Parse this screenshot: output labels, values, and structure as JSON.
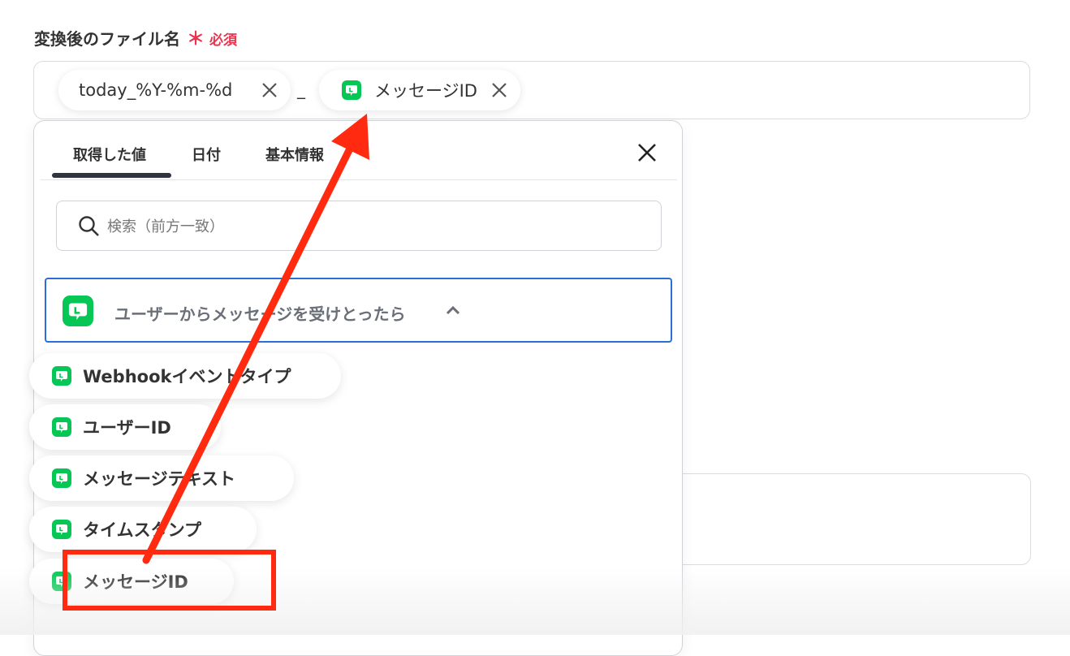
{
  "field": {
    "label": "変換後のファイル名",
    "required_star": "＊",
    "required_text": "必須",
    "chips": [
      {
        "label": "today_%Y-%m-%d",
        "icon": "none"
      },
      {
        "label": "メッセージID",
        "icon": "line-icon"
      }
    ],
    "separator": "_"
  },
  "panel": {
    "tabs": [
      {
        "label": "取得した値",
        "active": true
      },
      {
        "label": "日付",
        "active": false
      },
      {
        "label": "基本情報",
        "active": false
      }
    ],
    "close_icon": "close-icon",
    "search": {
      "placeholder": "検索（前方一致）",
      "value": ""
    },
    "group": {
      "title": "ユーザーからメッセージを受けとったら",
      "expanded": true,
      "icon": "line-icon",
      "items": [
        {
          "label": "Webhookイベントタイプ"
        },
        {
          "label": "ユーザーID"
        },
        {
          "label": "メッセージテキスト"
        },
        {
          "label": "タイムスタンプ"
        },
        {
          "label": "メッセージID"
        }
      ]
    }
  },
  "annotation": {
    "color": "#ff2a0f",
    "highlighted_item": "メッセージID"
  },
  "colors": {
    "line_green": "#06c755",
    "focus_blue": "#2a6fd6",
    "required_red": "#e8344e"
  }
}
